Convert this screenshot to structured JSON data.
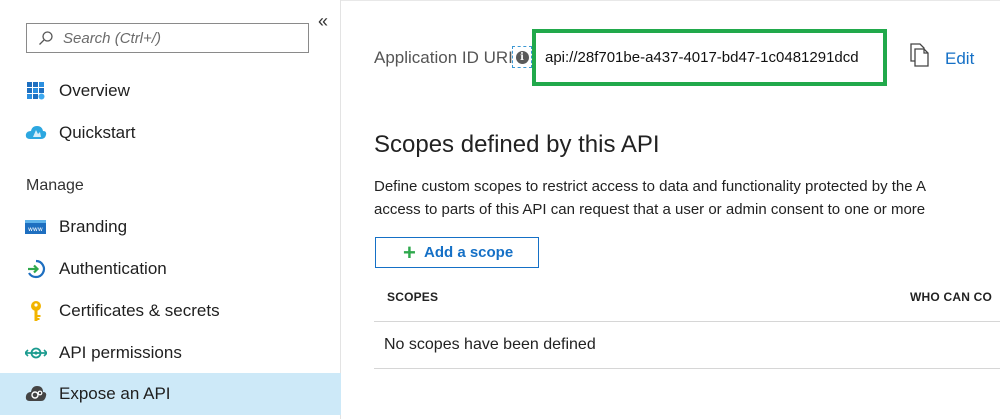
{
  "sidebar": {
    "search_placeholder": "Search (Ctrl+/)",
    "collapse_glyph": "«",
    "items_top": [
      {
        "label": "Overview",
        "icon": "grid-icon"
      },
      {
        "label": "Quickstart",
        "icon": "cloud-icon"
      }
    ],
    "section_label": "Manage",
    "items_manage": [
      {
        "label": "Branding",
        "icon": "branding-icon"
      },
      {
        "label": "Authentication",
        "icon": "authentication-icon"
      },
      {
        "label": "Certificates & secrets",
        "icon": "key-icon"
      },
      {
        "label": "API permissions",
        "icon": "api-permissions-icon"
      },
      {
        "label": "Expose an API",
        "icon": "expose-api-icon",
        "active": true
      }
    ]
  },
  "main": {
    "app_id_label": "Application ID URI",
    "info_glyph": "i",
    "app_id_uri": "api://28f701be-a437-4017-bd47-1c0481291dcd",
    "edit_label": "Edit",
    "scopes_heading": "Scopes defined by this API",
    "scopes_desc_line1": "Define custom scopes to restrict access to data and functionality protected by the A",
    "scopes_desc_line2": "access to parts of this API can request that a user or admin consent to one or more",
    "add_scope_label": "Add a scope",
    "add_plus": "+",
    "table": {
      "columns": [
        "SCOPES",
        "WHO CAN CO"
      ],
      "empty_message": "No scopes have been defined"
    }
  },
  "colors": {
    "highlight_border": "#21a94b",
    "link": "#1570c6",
    "active_nav_bg": "#cde9f8",
    "plus_green": "#2ea84c"
  }
}
